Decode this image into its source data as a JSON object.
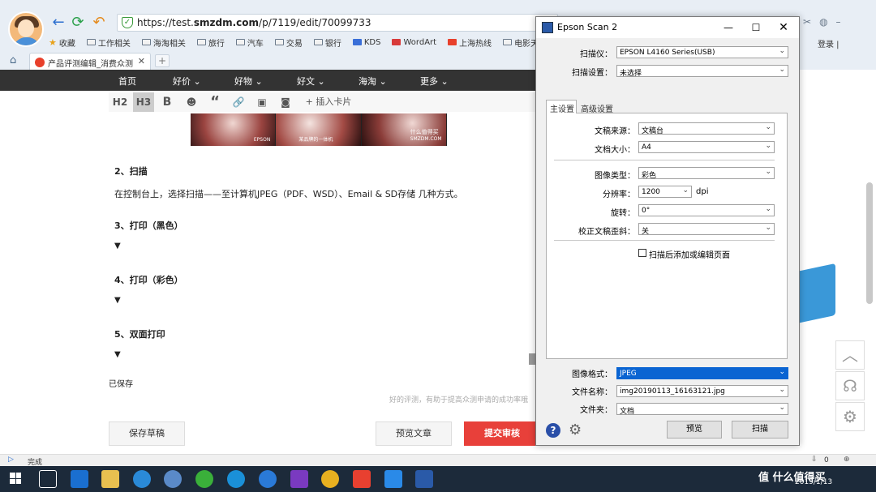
{
  "browser": {
    "url_prefix": "https://test.",
    "url_host": "smzdm.com",
    "url_path": "/p/7119/edit/70099733",
    "bookmarks": [
      "收藏",
      "工作相关",
      "海淘相关",
      "旅行",
      "汽车",
      "交易",
      "银行",
      "KDS",
      "WordArt",
      "上海热线",
      "电影天堂"
    ],
    "tab_title": "产品评测编辑_消费众测",
    "login_label": "登录 |",
    "status_text": "完成",
    "status_count": "0"
  },
  "site_nav": [
    "首页",
    "好价",
    "好物",
    "好文",
    "海淘",
    "更多"
  ],
  "editor_toolbar": {
    "h2": "H2",
    "h3": "H3",
    "bold": "B",
    "quote": "“",
    "insert_card": "插入卡片"
  },
  "content": {
    "image_captions": [
      "EPSON",
      "某品牌的一体机",
      "什么值得买",
      "SMZDM.COM"
    ],
    "section2_title": "2、扫描",
    "section2_text": "在控制台上，选择扫描——至计算机JPEG（PDF、WSD）、Email & SD存储 几种方式。",
    "section3_title": "3、打印（黑色）",
    "section4_title": "4、打印（彩色）",
    "section5_title": "5、双面打印",
    "arrow": "▼",
    "saved": "已保存",
    "hint": "好的评测，有助于提高众测申请的成功率哦",
    "save_draft": "保存草稿",
    "preview": "预览文章",
    "submit": "提交审核"
  },
  "dialog": {
    "title": "Epson Scan 2",
    "scanner_label": "扫描仪：",
    "scanner_value": "EPSON L4160 Series(USB)",
    "settings_label": "扫描设置：",
    "settings_value": "未选择",
    "tab_main": "主设置",
    "tab_advanced": "高级设置",
    "source_label": "文稿来源：",
    "source_value": "文稿台",
    "size_label": "文档大小：",
    "size_value": "A4",
    "image_type_label": "图像类型：",
    "image_type_value": "彩色",
    "resolution_label": "分辨率：",
    "resolution_value": "1200",
    "resolution_unit": "dpi",
    "rotate_label": "旋转：",
    "rotate_value": "0°",
    "skew_label": "校正文稿歪斜：",
    "skew_value": "关",
    "add_pages_label": "扫描后添加或编辑页面",
    "format_label": "图像格式：",
    "format_value": "JPEG",
    "filename_label": "文件名称：",
    "filename_value": "img20190113_16163121.jpg",
    "folder_label": "文件夹：",
    "folder_value": "文档",
    "preview_button": "预览",
    "scan_button": "扫描"
  },
  "taskbar": {
    "clock": "2019/1/13",
    "brand": "值 什么值得买"
  }
}
